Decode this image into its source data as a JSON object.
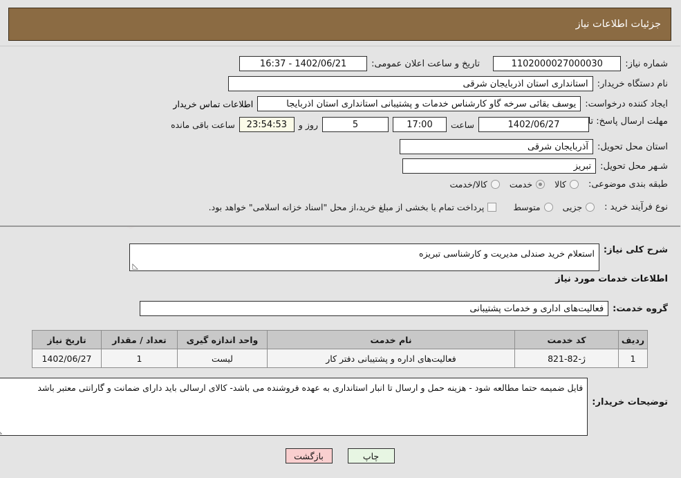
{
  "header": {
    "title": "جزئیات اطلاعات نیاز"
  },
  "form": {
    "need_number_label": "شماره نیاز:",
    "need_number_value": "1102000027000030",
    "announce_datetime_label": "تاریخ و ساعت اعلان عمومی:",
    "announce_datetime_value": "1402/06/21 - 16:37",
    "buyer_org_label": "نام دستگاه خریدار:",
    "buyer_org_value": "استانداری استان اذربایجان شرقی",
    "requester_label": "ایجاد کننده درخواست:",
    "requester_value": "یوسف بقائی سرخه گاو کارشناس خدمات و پشتیبانی استانداری استان اذربایجا",
    "contact_link": "اطلاعات تماس خریدار",
    "deadline_label": "مهلت ارسال پاسخ: تا تاریخ:",
    "deadline_date": "1402/06/27",
    "hour_label": "ساعت",
    "deadline_time": "17:00",
    "days_remaining": "5",
    "days_label": "روز و",
    "countdown": "23:54:53",
    "remaining_label": "ساعت باقی مانده",
    "delivery_province_label": "استان محل تحویل:",
    "delivery_province_value": "آذربایجان شرقی",
    "delivery_city_label": "شـهر محل تحویل:",
    "delivery_city_value": "تبریز",
    "category_label": "طبقه بندی موضوعی:",
    "category_options": [
      {
        "label": "کالا",
        "selected": false
      },
      {
        "label": "خدمت",
        "selected": true
      },
      {
        "label": "کالا/خدمت",
        "selected": false
      }
    ],
    "process_type_label": "نوع فرآیند خرید :",
    "process_options": [
      {
        "label": "جزیی",
        "selected": false
      },
      {
        "label": "متوسط",
        "selected": false
      }
    ],
    "treasury_checkbox_label": "پرداخت تمام یا بخشی از مبلغ خرید،از محل \"اسناد خزانه اسلامی\" خواهد بود.",
    "treasury_checked": false
  },
  "overview": {
    "label": "شرح کلی نیاز:",
    "value": "استعلام خرید صندلی مدیریت و کارشناسی تبریزه"
  },
  "services_section": {
    "heading": "اطلاعات خدمات مورد نیاز",
    "group_label": "گروه خدمت:",
    "group_value": "فعالیت‌های اداری و خدمات پشتیبانی"
  },
  "table": {
    "columns": [
      "ردیف",
      "کد خدمت",
      "نام خدمت",
      "واحد اندازه گیری",
      "تعداد / مقدار",
      "تاریخ نیاز"
    ],
    "rows": [
      {
        "index": "1",
        "service_code": "ژ-82-821",
        "service_name": "فعالیت‌های اداره و پشتیبانی دفتر کار",
        "unit": "لیست",
        "quantity": "1",
        "need_date": "1402/06/27"
      }
    ]
  },
  "remarks": {
    "label": "توضیحات خریدار:",
    "value": "فایل ضمیمه حتما مطالعه شود - هزینه حمل و ارسال تا انبار استانداری به عهده فروشنده می باشد- کالای ارسالی باید دارای ضمانت و گارانتی معتبر باشد"
  },
  "footer": {
    "back_label": "بازگشت",
    "print_label": "چاپ"
  },
  "colors": {
    "header_bg": "#8b6b43",
    "link": "#1414d2",
    "back_btn": "#f9cfcf",
    "print_btn": "#e7f6e3",
    "countdown_bg": "#fbfbe8"
  }
}
